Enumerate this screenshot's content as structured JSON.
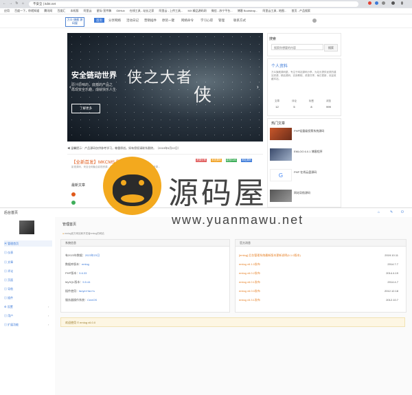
{
  "browser": {
    "nav": [
      "←",
      "→",
      "↻",
      "⌂"
    ],
    "address": "不安全 | itdt4.net",
    "bookmarks": [
      "应用",
      "百度一下，你就知道",
      "腾讯网",
      "百度汇",
      "本机版",
      "阿里云",
      "星际·宣传稿",
      "GitHub",
      "在线工具 - 站长之家",
      "阿里云 - 上传工具...",
      "MX 精品源码网",
      "微信 - 苏宁平台...",
      "博客 Bootstrap...",
      "阿里云工具 - 地图...",
      "首页 - 产品搜索"
    ]
  },
  "site": {
    "logo": "万众·旗舰 源码屋",
    "menu": [
      "首页",
      "分享网络",
      "活动日记",
      "营销插件",
      "原装一键",
      "网络命令",
      "学习心得",
      "管理",
      "联系方式"
    ],
    "menu_active": "首页",
    "banner": {
      "title": "安全链动世界",
      "subtitle": "原汁原味的，底蕴的产品之\n再现安全乐趣，成就快乐人生",
      "button": "了解更多",
      "calligraphy": "侠之大者",
      "calligraphy2": "侠"
    },
    "ticker": "温馨提示：产品源码仅供参考学习，尊重原创。如有侵权请联系删除。（2019年5月22日）",
    "post": {
      "title": "【全新首发】MKCMS 影视源码 V7.0",
      "tags": [
        "资源分享",
        "系统源码",
        "影视CMS",
        "网站源码"
      ],
      "meta": "影视源码，来自全网聚合影视资源，全新后台管理，支持后台一键采集，海量资源...",
      "section": "最新文章"
    },
    "sidebar": {
      "search_title": "搜索",
      "search_placeholder": "搜索你想要的内容",
      "search_button": "搜索",
      "profile_title": "个人资料",
      "profile_text": "万众旗舰源码屋，专注于网站源码分享，为站长提供优质的建站资源，精品源码、实用教程、资源共享，每日更新，欢迎收藏本站。",
      "stats": [
        [
          "文章",
          "12"
        ],
        [
          "评论",
          "5"
        ],
        [
          "标签",
          "8"
        ],
        [
          "浏览",
          "999"
        ]
      ],
      "hot_title": "热门文章",
      "hot": [
        "PHP轻量级投票系统源码",
        "EMLOG 6.0.1 博客程序",
        "PHP 在线云盘源码",
        "网站导航源码"
      ]
    }
  },
  "watermark": {
    "brand": "源码屋",
    "url": "www.yuanmawu.net"
  },
  "admin": {
    "title": "后台首页",
    "side": [
      "管理首页",
      "仪表",
      "文章",
      "评论",
      "页面",
      "导航",
      "插件",
      "设置",
      "用户",
      "扩展功能"
    ],
    "welcome": "管理首页",
    "crumb": "emlog官方网站和开发者emlog的网站",
    "sys_panel": "系统信息",
    "sys_rows": [
      [
        "有2023年数据：",
        "2023年23日"
      ],
      [
        "数据库版本：",
        "emlog"
      ],
      [
        "PHP版本：",
        "5.6.33"
      ],
      [
        "MySQL版本：",
        "5.5.44"
      ],
      [
        "插件使用：",
        "fanyin+fan+s"
      ],
      [
        "服务器操作系统：",
        "CentOS"
      ]
    ],
    "ver_panel": "官方消息",
    "ver_rows": [
      [
        "[emlog] 后台管理系统最新版本更新说明(6.1.0版本)",
        "2019.10.11"
      ],
      [
        "emlog v6.1.0发布",
        "2014.7.7"
      ],
      [
        "emlog v6.0.2发布",
        "2014.4.19"
      ],
      [
        "emlog v6.0.1发布",
        "2014.4.7"
      ],
      [
        "emlog v6.0.0发布",
        "2012.12.18"
      ],
      [
        "emlog v5.3.1发布",
        "2012.10.7"
      ]
    ],
    "copyright": "欢迎使用 © emlog v6.0.0"
  }
}
